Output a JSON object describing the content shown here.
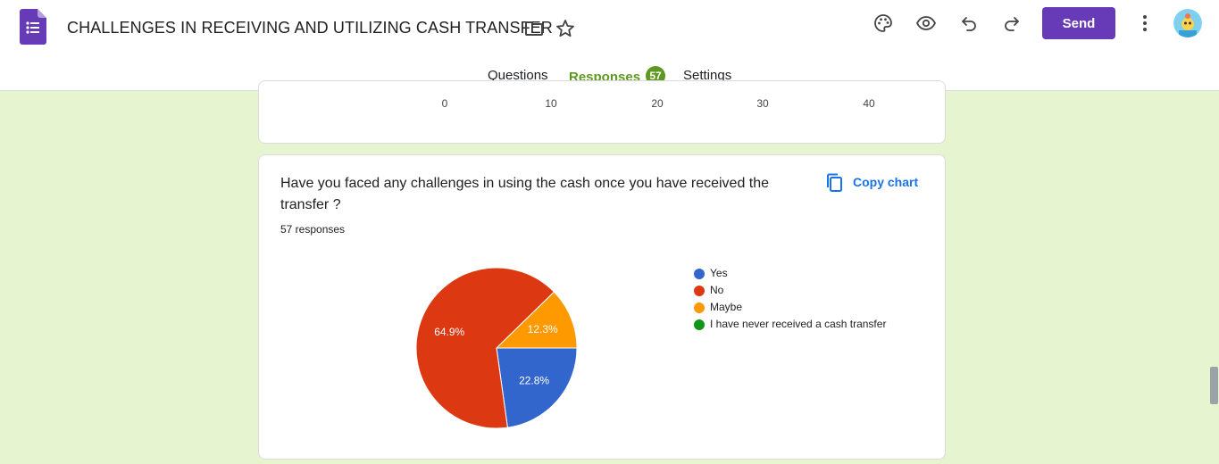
{
  "header": {
    "title": "CHALLENGES IN RECEIVING AND UTILIZING CASH TRANSFER",
    "send_label": "Send",
    "icons": [
      "forms-app-icon",
      "folder-icon",
      "star-icon",
      "palette-icon",
      "preview-eye-icon",
      "undo-icon",
      "redo-icon",
      "more-vert-icon",
      "avatar"
    ],
    "accent_color": "#673ab7"
  },
  "tabs": [
    {
      "label": "Questions"
    },
    {
      "label": "Responses",
      "badge": "57",
      "active": true
    },
    {
      "label": "Settings"
    }
  ],
  "previous_chart": {
    "axis_ticks": [
      "0",
      "10",
      "20",
      "30",
      "40"
    ]
  },
  "question_card": {
    "question": "Have you faced any challenges in using the cash once you have received the transfer ?",
    "response_count": "57 responses",
    "copy_chart_label": "Copy chart"
  },
  "chart_data": {
    "type": "pie",
    "title": "",
    "slices": [
      {
        "label": "Yes",
        "value": 22.8,
        "display": "22.8%",
        "color": "#3366cc"
      },
      {
        "label": "No",
        "value": 64.9,
        "display": "64.9%",
        "color": "#dc3912"
      },
      {
        "label": "Maybe",
        "value": 12.3,
        "display": "12.3%",
        "color": "#ff9900"
      },
      {
        "label": "I have never received a cash transfer",
        "value": 0,
        "display": "",
        "color": "#109618"
      }
    ],
    "legend_position": "right"
  }
}
